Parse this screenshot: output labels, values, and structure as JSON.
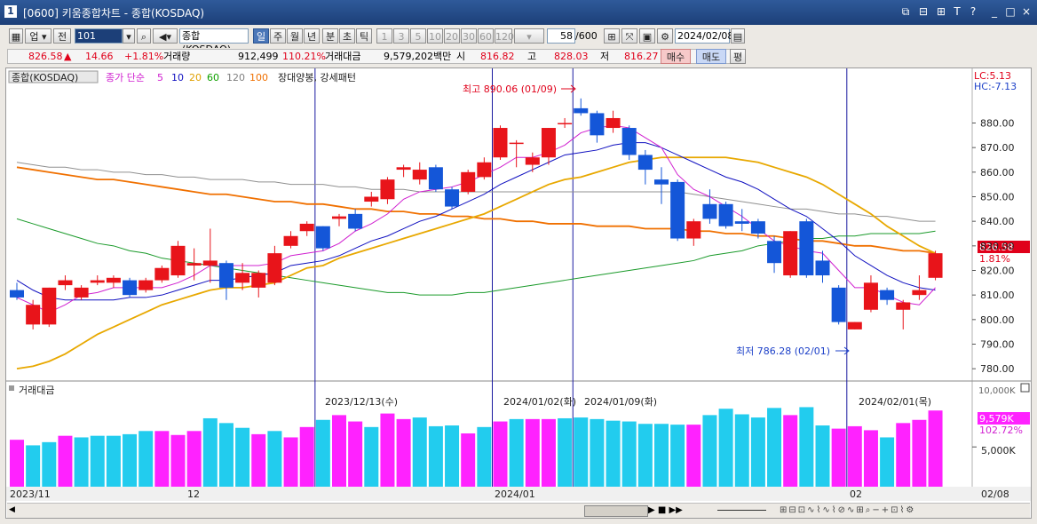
{
  "window": {
    "number": "1",
    "title": "[0600] 키움종합차트 - 종합(KOSDAQ)",
    "controls": [
      "⧉",
      "⊟",
      "⊞",
      "T",
      "?",
      "_",
      "□",
      "×"
    ]
  },
  "toolbar": {
    "market": "업",
    "prev": "전",
    "code": "101",
    "name": "종합(KOSDAQ)",
    "periods": [
      "일",
      "주",
      "월",
      "년",
      "분",
      "초",
      "틱"
    ],
    "active_period": "일",
    "intervals": [
      "1",
      "3",
      "5",
      "10",
      "20",
      "30",
      "60",
      "120"
    ],
    "count": "58",
    "total": "/600",
    "date": "2024/02/08"
  },
  "quote": {
    "price": "826.58",
    "arrow": "▲",
    "change": "14.66",
    "change_pct": "+1.81%",
    "volume_label": "거래량",
    "volume": "912,499",
    "volume_pct": "110.21%",
    "amount_label": "거래대금",
    "amount": "9,579,202백만",
    "open_label": "시",
    "open": "816.82",
    "high_label": "고",
    "high": "828.03",
    "low_label": "저",
    "low": "816.27",
    "buy": "매수",
    "sell": "매도",
    "eval": "평"
  },
  "legend": {
    "index": "종합(KOSDAQ)",
    "ma_title": "종가 단순",
    "ma_periods": [
      "5",
      "10",
      "20",
      "60",
      "120",
      "100"
    ],
    "ma_colors": [
      "#d020d0",
      "#1010c0",
      "#e0a000",
      "#10a000",
      "#808080",
      "#f07000"
    ],
    "pattern": "장대양봉, 강세패턴",
    "lc": "LC:5.13",
    "hc": "HC:-7.13"
  },
  "annotations": {
    "high": "최고 890.06 (01/09)",
    "low": "최저 786.28 (02/01)",
    "vlines": [
      "2023/12/13(수)",
      "2024/01/02(화)",
      "2024/01/09(화)",
      "2024/02/01(목)"
    ]
  },
  "volume_panel": {
    "title": "거래대금",
    "last": "9,579K",
    "pct": "102.72%",
    "axis_label": "5,000K",
    "top_label": "10,000K"
  },
  "price_axis": {
    "current": "826.58",
    "current_pct": "1.81%",
    "ticks": [
      "880.00",
      "870.00",
      "860.00",
      "850.00",
      "840.00",
      "830.00",
      "820.00",
      "810.00",
      "800.00",
      "790.00",
      "780.00"
    ]
  },
  "time_axis": {
    "labels": [
      "2023/11",
      "12",
      "2024/01",
      "02",
      "02/08"
    ]
  },
  "chart_data": {
    "type": "candlestick",
    "ylim": [
      775,
      895
    ],
    "candles": [
      {
        "o": 812,
        "h": 815,
        "l": 808,
        "c": 809
      },
      {
        "o": 798,
        "h": 808,
        "l": 796,
        "c": 806
      },
      {
        "o": 798,
        "h": 812,
        "l": 797,
        "c": 813
      },
      {
        "o": 814,
        "h": 818,
        "l": 812,
        "c": 816
      },
      {
        "o": 809,
        "h": 814,
        "l": 808,
        "c": 813
      },
      {
        "o": 815,
        "h": 818,
        "l": 814,
        "c": 816
      },
      {
        "o": 815,
        "h": 818,
        "l": 813,
        "c": 817
      },
      {
        "o": 816,
        "h": 817,
        "l": 809,
        "c": 810
      },
      {
        "o": 812,
        "h": 817,
        "l": 811,
        "c": 816
      },
      {
        "o": 816,
        "h": 822,
        "l": 815,
        "c": 821
      },
      {
        "o": 818,
        "h": 832,
        "l": 817,
        "c": 830
      },
      {
        "o": 822,
        "h": 829,
        "l": 816,
        "c": 823
      },
      {
        "o": 822,
        "h": 837,
        "l": 815,
        "c": 824
      },
      {
        "o": 823,
        "h": 824,
        "l": 808,
        "c": 813
      },
      {
        "o": 815,
        "h": 823,
        "l": 812,
        "c": 819
      },
      {
        "o": 813,
        "h": 820,
        "l": 809,
        "c": 819
      },
      {
        "o": 815,
        "h": 830,
        "l": 814,
        "c": 827
      },
      {
        "o": 830,
        "h": 836,
        "l": 829,
        "c": 834
      },
      {
        "o": 836,
        "h": 840,
        "l": 834,
        "c": 839
      },
      {
        "o": 838,
        "h": 836,
        "l": 828,
        "c": 829
      },
      {
        "o": 841,
        "h": 843,
        "l": 838,
        "c": 842
      },
      {
        "o": 843,
        "h": 845,
        "l": 836,
        "c": 837
      },
      {
        "o": 848,
        "h": 852,
        "l": 846,
        "c": 850
      },
      {
        "o": 849,
        "h": 858,
        "l": 847,
        "c": 857
      },
      {
        "o": 861,
        "h": 863,
        "l": 858,
        "c": 862
      },
      {
        "o": 857,
        "h": 864,
        "l": 855,
        "c": 861
      },
      {
        "o": 862,
        "h": 863,
        "l": 852,
        "c": 853
      },
      {
        "o": 853,
        "h": 854,
        "l": 845,
        "c": 846
      },
      {
        "o": 852,
        "h": 861,
        "l": 851,
        "c": 860
      },
      {
        "o": 858,
        "h": 866,
        "l": 857,
        "c": 864
      },
      {
        "o": 866,
        "h": 879,
        "l": 865,
        "c": 878
      },
      {
        "o": 872,
        "h": 873,
        "l": 862,
        "c": 872
      },
      {
        "o": 863,
        "h": 868,
        "l": 860,
        "c": 866
      },
      {
        "o": 866,
        "h": 878,
        "l": 863,
        "c": 878
      },
      {
        "o": 880,
        "h": 882,
        "l": 878,
        "c": 880
      },
      {
        "o": 886,
        "h": 890,
        "l": 883,
        "c": 884
      },
      {
        "o": 884,
        "h": 885,
        "l": 872,
        "c": 875
      },
      {
        "o": 878,
        "h": 885,
        "l": 876,
        "c": 882
      },
      {
        "o": 878,
        "h": 879,
        "l": 865,
        "c": 867
      },
      {
        "o": 867,
        "h": 869,
        "l": 855,
        "c": 861
      },
      {
        "o": 857,
        "h": 862,
        "l": 847,
        "c": 855
      },
      {
        "o": 856,
        "h": 857,
        "l": 832,
        "c": 833
      },
      {
        "o": 833,
        "h": 841,
        "l": 830,
        "c": 840
      },
      {
        "o": 847,
        "h": 853,
        "l": 839,
        "c": 841
      },
      {
        "o": 847,
        "h": 848,
        "l": 837,
        "c": 838
      },
      {
        "o": 840,
        "h": 845,
        "l": 836,
        "c": 839
      },
      {
        "o": 840,
        "h": 841,
        "l": 833,
        "c": 835
      },
      {
        "o": 832,
        "h": 834,
        "l": 819,
        "c": 823
      },
      {
        "o": 818,
        "h": 834,
        "l": 817,
        "c": 836
      },
      {
        "o": 840,
        "h": 841,
        "l": 817,
        "c": 818
      },
      {
        "o": 824,
        "h": 828,
        "l": 815,
        "c": 818
      },
      {
        "o": 813,
        "h": 814,
        "l": 798,
        "c": 799
      },
      {
        "o": 796,
        "h": 799,
        "l": 796,
        "c": 799
      },
      {
        "o": 804,
        "h": 818,
        "l": 803,
        "c": 815
      },
      {
        "o": 812,
        "h": 813,
        "l": 806,
        "c": 808
      },
      {
        "o": 804,
        "h": 808,
        "l": 796,
        "c": 807
      },
      {
        "o": 810,
        "h": 818,
        "l": 808,
        "c": 812
      },
      {
        "o": 817,
        "h": 828,
        "l": 816,
        "c": 827
      }
    ],
    "amount_thousands": [
      5900,
      5200,
      5600,
      6400,
      6200,
      6400,
      6400,
      6600,
      7000,
      7000,
      6500,
      7000,
      8600,
      8000,
      7400,
      6600,
      7000,
      6200,
      7500,
      8400,
      9000,
      8200,
      7500,
      9200,
      8500,
      8700,
      7600,
      7700,
      6700,
      7500,
      8200,
      8500,
      8500,
      8500,
      8600,
      8700,
      8500,
      8300,
      8200,
      7900,
      7900,
      7800,
      7800,
      9000,
      9800,
      9100,
      8700,
      9900,
      9000,
      10000,
      7700,
      7300,
      7600,
      7100,
      6200,
      8000,
      8400,
      9579
    ],
    "amount_color": [
      "m",
      "c",
      "c",
      "m",
      "c",
      "c",
      "c",
      "c",
      "c",
      "m",
      "m",
      "m",
      "c",
      "c",
      "c",
      "m",
      "c",
      "m",
      "m",
      "c",
      "m",
      "m",
      "c",
      "m",
      "m",
      "c",
      "c",
      "c",
      "m",
      "c",
      "m",
      "c",
      "m",
      "m",
      "c",
      "c",
      "c",
      "c",
      "c",
      "c",
      "c",
      "c",
      "m",
      "c",
      "c",
      "c",
      "c",
      "c",
      "m",
      "c",
      "c",
      "m",
      "m",
      "m",
      "c",
      "m",
      "m",
      "m"
    ],
    "ma5": [
      809,
      806,
      803,
      806,
      810,
      811,
      813,
      813,
      813,
      813,
      815,
      818,
      822,
      822,
      822,
      822,
      823,
      826,
      827,
      828,
      831,
      836,
      839,
      843,
      849,
      852,
      853,
      854,
      856,
      859,
      862,
      866,
      866,
      868,
      871,
      876,
      878,
      879,
      878,
      874,
      870,
      859,
      853,
      850,
      846,
      842,
      837,
      832,
      830,
      828,
      827,
      820,
      813,
      813,
      810,
      807,
      806,
      813
    ],
    "ma10": [
      816,
      812,
      809,
      808,
      808,
      808,
      808,
      809,
      809,
      810,
      812,
      814,
      816,
      816,
      817,
      818,
      819,
      822,
      823,
      824,
      826,
      829,
      832,
      834,
      837,
      840,
      842,
      845,
      848,
      851,
      855,
      858,
      861,
      864,
      867,
      868,
      869,
      871,
      872,
      872,
      870,
      867,
      864,
      861,
      858,
      856,
      853,
      849,
      845,
      842,
      837,
      832,
      826,
      822,
      818,
      815,
      813,
      812
    ],
    "ma20": [
      780,
      781,
      783,
      786,
      790,
      794,
      797,
      800,
      803,
      806,
      808,
      810,
      812,
      813,
      813,
      814,
      815,
      818,
      821,
      822,
      825,
      827,
      829,
      831,
      833,
      835,
      837,
      839,
      841,
      843,
      846,
      849,
      852,
      855,
      857,
      858,
      860,
      862,
      864,
      865,
      866,
      866,
      866,
      866,
      866,
      865,
      864,
      862,
      860,
      858,
      855,
      851,
      847,
      843,
      838,
      834,
      830,
      827
    ],
    "ma60": [
      841,
      839,
      837,
      835,
      833,
      831,
      830,
      828,
      827,
      825,
      824,
      823,
      822,
      821,
      820,
      819,
      818,
      817,
      816,
      815,
      814,
      813,
      812,
      811,
      811,
      810,
      810,
      810,
      811,
      811,
      812,
      813,
      814,
      815,
      816,
      817,
      818,
      819,
      820,
      821,
      822,
      823,
      824,
      826,
      827,
      828,
      830,
      831,
      832,
      833,
      833,
      834,
      834,
      835,
      835,
      835,
      835,
      836
    ],
    "ma120": [
      864,
      863,
      862,
      862,
      861,
      861,
      860,
      860,
      859,
      859,
      858,
      858,
      857,
      857,
      857,
      856,
      856,
      855,
      855,
      855,
      854,
      854,
      853,
      853,
      853,
      852,
      852,
      852,
      852,
      852,
      852,
      852,
      852,
      852,
      852,
      852,
      852,
      852,
      852,
      852,
      852,
      852,
      851,
      850,
      849,
      848,
      847,
      846,
      845,
      845,
      844,
      843,
      843,
      842,
      842,
      841,
      840,
      840
    ],
    "ma100": [
      862,
      861,
      860,
      859,
      858,
      857,
      857,
      856,
      855,
      854,
      853,
      852,
      851,
      851,
      850,
      849,
      848,
      848,
      847,
      847,
      846,
      845,
      845,
      844,
      844,
      843,
      843,
      842,
      842,
      841,
      841,
      840,
      840,
      839,
      839,
      839,
      838,
      838,
      838,
      837,
      837,
      837,
      836,
      836,
      835,
      835,
      834,
      834,
      833,
      832,
      832,
      831,
      830,
      830,
      829,
      828,
      828,
      827
    ]
  }
}
